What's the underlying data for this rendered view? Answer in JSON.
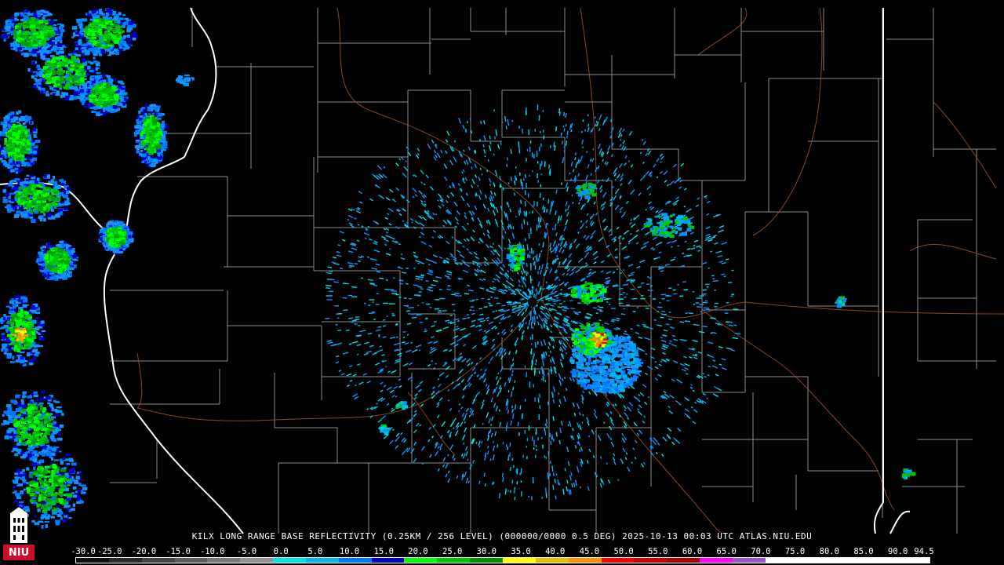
{
  "caption": "KILX LONG RANGE BASE REFLECTIVITY (0.25KM / 256 LEVEL) (000000/0000 0.5 DEG) 2025-10-13 00:03 UTC  ATLAS.NIU.EDU",
  "logo": {
    "text": "NIU",
    "icon": "niu-tower-logo-icon",
    "color": "#c8102e"
  },
  "scale": {
    "labels": [
      "-30.0",
      "-25.0",
      "-20.0",
      "-15.0",
      "-10.0",
      "-5.0",
      "0.0",
      "5.0",
      "10.0",
      "15.0",
      "20.0",
      "25.0",
      "30.0",
      "35.0",
      "40.0",
      "45.0",
      "50.0",
      "55.0",
      "60.0",
      "65.0",
      "70.0",
      "75.0",
      "80.0",
      "85.0",
      "90.0",
      "94.5"
    ],
    "colors": [
      "#101010",
      "#2a2a2a",
      "#444444",
      "#5e5e5e",
      "#787878",
      "#929292",
      "#00e6e6",
      "#00b4f0",
      "#0078ff",
      "#0000d0",
      "#00ff00",
      "#00c800",
      "#009000",
      "#ffff00",
      "#e6c000",
      "#ff9000",
      "#ff0000",
      "#d40000",
      "#b00000",
      "#ff00ff",
      "#9955c9",
      "#ffffff",
      "#ffffff",
      "#ffffff",
      "#ffffff",
      "#ffffff"
    ]
  },
  "colors": {
    "background": "#000000",
    "county": "#9a9a9a",
    "state": "#ffffff",
    "highway": "#a0522d"
  }
}
